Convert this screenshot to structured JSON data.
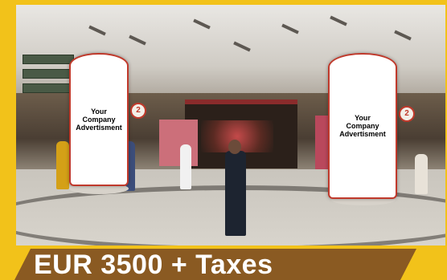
{
  "kiosk_left": {
    "label": "Your\nCompany\nAdvertisment"
  },
  "kiosk_right": {
    "label": "Your\nCompany\nAdvertisment"
  },
  "pillar_numbers": {
    "left": "2",
    "right": "2"
  },
  "price": {
    "text": "EUR 3500 + Taxes"
  },
  "colors": {
    "frame": "#f2c21a",
    "price_bar": "#8a5a22",
    "kiosk_border": "#c0392b"
  }
}
